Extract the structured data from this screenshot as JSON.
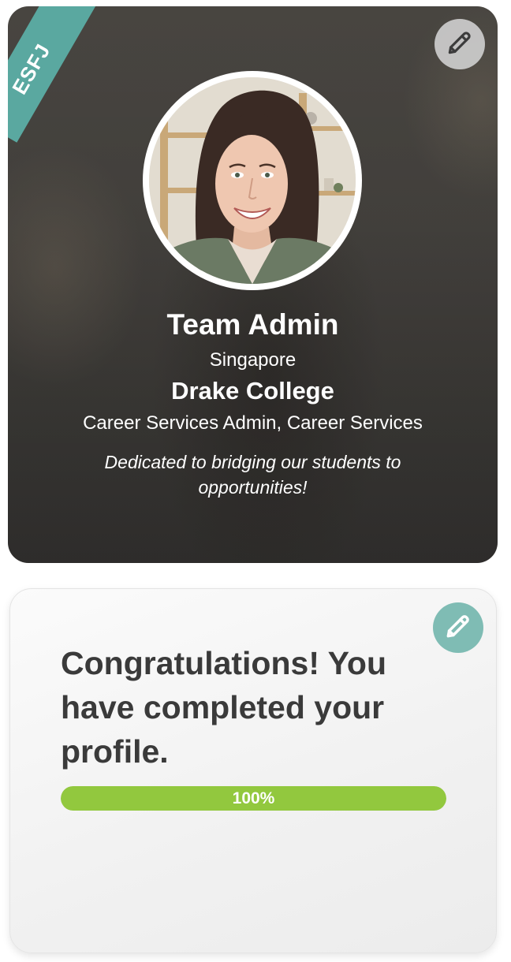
{
  "profile": {
    "personality_badge": "ESFJ",
    "name": "Team Admin",
    "location": "Singapore",
    "college": "Drake College",
    "role": "Career Services Admin, Career Services",
    "bio": "Dedicated to bridging our students to opportunities!",
    "edit_icon": "pencil-icon"
  },
  "completion": {
    "message": "Congratulations! You have completed your profile.",
    "progress_percent": 100,
    "progress_label": "100%",
    "edit_icon": "pencil-icon"
  },
  "colors": {
    "ribbon": "#5aa8a0",
    "progress_fill": "#92c83e",
    "edit_button_teal": "#7fbcb4",
    "heading_text": "#3a3a3a"
  }
}
